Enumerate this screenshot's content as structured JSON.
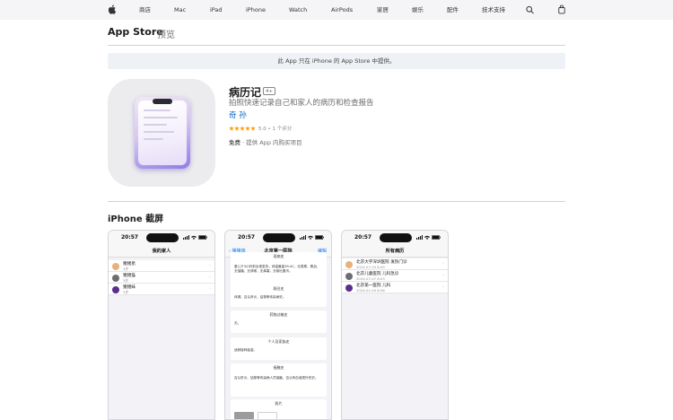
{
  "global_nav": {
    "items": [
      "商店",
      "Mac",
      "iPad",
      "iPhone",
      "Watch",
      "AirPods",
      "家居",
      "娱乐",
      "配件",
      "技术支持"
    ]
  },
  "header": {
    "brand": "App Store",
    "section": "预览"
  },
  "banner": "此 App 只在 iPhone 的 App Store 中提供。",
  "app": {
    "title": "病历记",
    "age_rating": "4+",
    "subtitle": "拍照快速记录自己和家人的病历和检查报告",
    "developer": "奇 孙",
    "rating": 5.0,
    "rating_text": "5.0 • 1 个评分",
    "price": "免费",
    "iap": " · 提供 App 内购买项目"
  },
  "screenshots_title": "iPhone 截屏",
  "screenshots": [
    {
      "time": "20:57",
      "title": "我的家人",
      "members": [
        {
          "name": "猪猪弟",
          "age": "3岁",
          "color": "#e8b07a"
        },
        {
          "name": "猪猪猫",
          "age": "3岁",
          "color": "#6d6d72"
        },
        {
          "name": "猪猪妹",
          "age": "2岁",
          "color": "#5b2d8e"
        }
      ]
    },
    {
      "time": "20:57",
      "back": "猪猪妹",
      "title": "北京第一医院",
      "edit": "编辑",
      "sections": [
        {
          "title": "现病史",
          "body": "患儿于3小时前出现发热，体温最高39.4C，无畏寒、寒战，无抽搐，无咳嗽，无鼻塞，无呕吐腹泻。"
        },
        {
          "title": "既往史",
          "body": "体健。否认肝炎、结核等传染病史。"
        },
        {
          "title": "药物过敏史",
          "body": "无。"
        },
        {
          "title": "个人及家族史",
          "body": "适龄接种疫苗。"
        },
        {
          "title": "接触史",
          "body": "否认肝炎、结核等传染病人员接触，否认有血液类外伤史。"
        },
        {
          "title": "照片",
          "body": ""
        }
      ]
    },
    {
      "time": "20:57",
      "title": "所有病历",
      "records": [
        {
          "name": "北京大学深圳医院 发热门诊",
          "date": "2024-07-10 8:49",
          "color": "#e8b07a"
        },
        {
          "name": "北京儿童医院 儿科急诊",
          "date": "2024-07-07 8:03",
          "color": "#6d6d72"
        },
        {
          "name": "北京第一医院 儿科",
          "date": "2024-01-04 8:36",
          "color": "#5b2d8e"
        }
      ]
    }
  ],
  "colors": {
    "link": "#0066cc",
    "star": "#ff9f0a",
    "ios_blue": "#0a7aff"
  }
}
